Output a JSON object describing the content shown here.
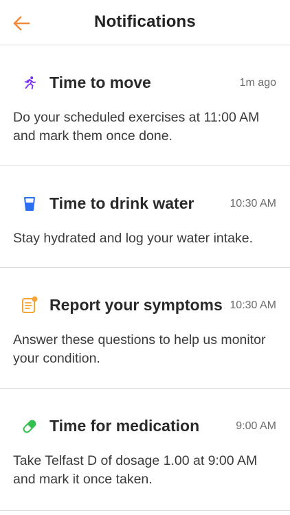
{
  "header": {
    "title": "Notifications",
    "back_icon": "arrow-left-icon",
    "accent": "#f08a3c"
  },
  "notifications": [
    {
      "icon": "running-person-icon",
      "icon_color": "#7b2ff7",
      "title": "Time to move",
      "time": "1m ago",
      "body": "Do your scheduled exercises at 11:00 AM and mark them once done."
    },
    {
      "icon": "water-glass-icon",
      "icon_color": "#2a6ef2",
      "title": "Time to drink water",
      "time": "10:30 AM",
      "body": "Stay hydrated and log your water intake."
    },
    {
      "icon": "clipboard-icon",
      "icon_color": "#f4a534",
      "title": "Report your symptoms",
      "time": "10:30 AM",
      "body": "Answer these questions to help us monitor your condition."
    },
    {
      "icon": "pill-icon",
      "icon_color": "#34c24f",
      "title": "Time for medication",
      "time": "9:00 AM",
      "body": "Take Telfast D of dosage 1.00 at 9:00 AM and mark it once taken."
    }
  ]
}
